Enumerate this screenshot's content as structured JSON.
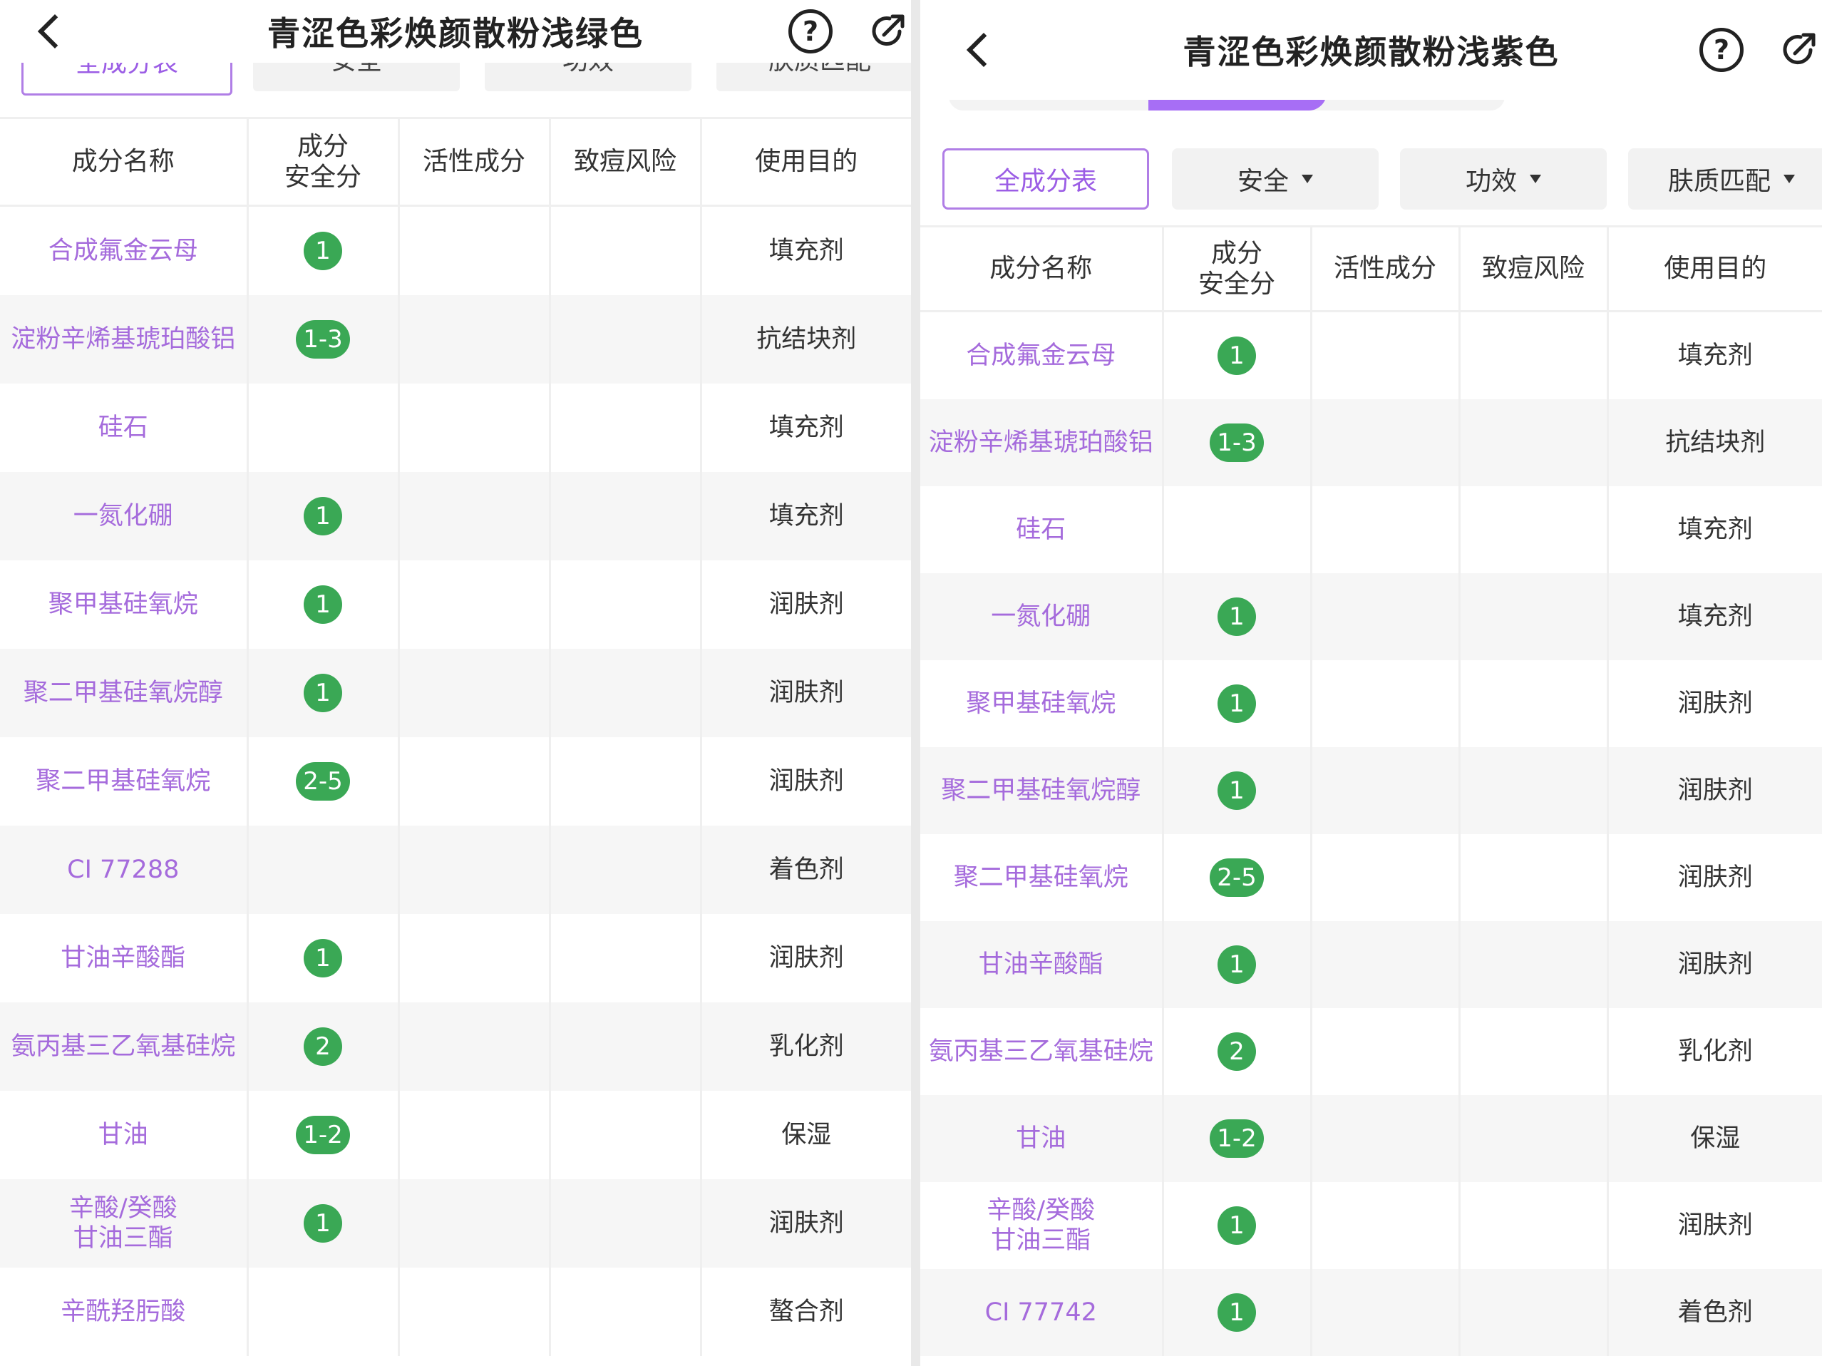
{
  "left": {
    "title": "青涩色彩焕颜散粉浅绿色",
    "help_glyph": "?",
    "tabs": [
      "全成分表",
      "安全",
      "功效",
      "肤质匹配"
    ],
    "columns": [
      "成分名称",
      "成分\n安全分",
      "活性成分",
      "致痘风险",
      "使用目的"
    ],
    "rows": [
      {
        "name": "合成氟金云母",
        "score": "1",
        "purpose": "填充剂"
      },
      {
        "name": "淀粉辛烯基琥珀酸铝",
        "score": "1-3",
        "purpose": "抗结块剂"
      },
      {
        "name": "硅石",
        "score": "",
        "purpose": "填充剂"
      },
      {
        "name": "一氮化硼",
        "score": "1",
        "purpose": "填充剂"
      },
      {
        "name": "聚甲基硅氧烷",
        "score": "1",
        "purpose": "润肤剂"
      },
      {
        "name": "聚二甲基硅氧烷醇",
        "score": "1",
        "purpose": "润肤剂"
      },
      {
        "name": "聚二甲基硅氧烷",
        "score": "2-5",
        "purpose": "润肤剂"
      },
      {
        "name": "CI 77288",
        "score": "",
        "purpose": "着色剂"
      },
      {
        "name": "甘油辛酸酯",
        "score": "1",
        "purpose": "润肤剂"
      },
      {
        "name": "氨丙基三乙氧基硅烷",
        "score": "2",
        "purpose": "乳化剂"
      },
      {
        "name": "甘油",
        "score": "1-2",
        "purpose": "保湿"
      },
      {
        "name": "辛酸/癸酸\n甘油三酯",
        "score": "1",
        "purpose": "润肤剂"
      },
      {
        "name": "辛酰羟肟酸",
        "score": "",
        "purpose": "螯合剂"
      }
    ]
  },
  "right": {
    "title": "青涩色彩焕颜散粉浅紫色",
    "help_glyph": "?",
    "tabs": [
      "全成分表",
      "安全",
      "功效",
      "肤质匹配"
    ],
    "columns": [
      "成分名称",
      "成分\n安全分",
      "活性成分",
      "致痘风险",
      "使用目的"
    ],
    "rows": [
      {
        "name": "合成氟金云母",
        "score": "1",
        "purpose": "填充剂"
      },
      {
        "name": "淀粉辛烯基琥珀酸铝",
        "score": "1-3",
        "purpose": "抗结块剂"
      },
      {
        "name": "硅石",
        "score": "",
        "purpose": "填充剂"
      },
      {
        "name": "一氮化硼",
        "score": "1",
        "purpose": "填充剂"
      },
      {
        "name": "聚甲基硅氧烷",
        "score": "1",
        "purpose": "润肤剂"
      },
      {
        "name": "聚二甲基硅氧烷醇",
        "score": "1",
        "purpose": "润肤剂"
      },
      {
        "name": "聚二甲基硅氧烷",
        "score": "2-5",
        "purpose": "润肤剂"
      },
      {
        "name": "甘油辛酸酯",
        "score": "1",
        "purpose": "润肤剂"
      },
      {
        "name": "氨丙基三乙氧基硅烷",
        "score": "2",
        "purpose": "乳化剂"
      },
      {
        "name": "甘油",
        "score": "1-2",
        "purpose": "保湿"
      },
      {
        "name": "辛酸/癸酸\n甘油三酯",
        "score": "1",
        "purpose": "润肤剂"
      },
      {
        "name": "CI 77742",
        "score": "1",
        "purpose": "着色剂"
      }
    ]
  },
  "colors": {
    "accent_purple": "#a56bdc",
    "badge_green": "#3aa855",
    "indicator_purple": "#a76ef5"
  },
  "icons": [
    "back-arrow-icon",
    "help-circle-icon",
    "share-icon",
    "dropdown-caret-icon"
  ]
}
